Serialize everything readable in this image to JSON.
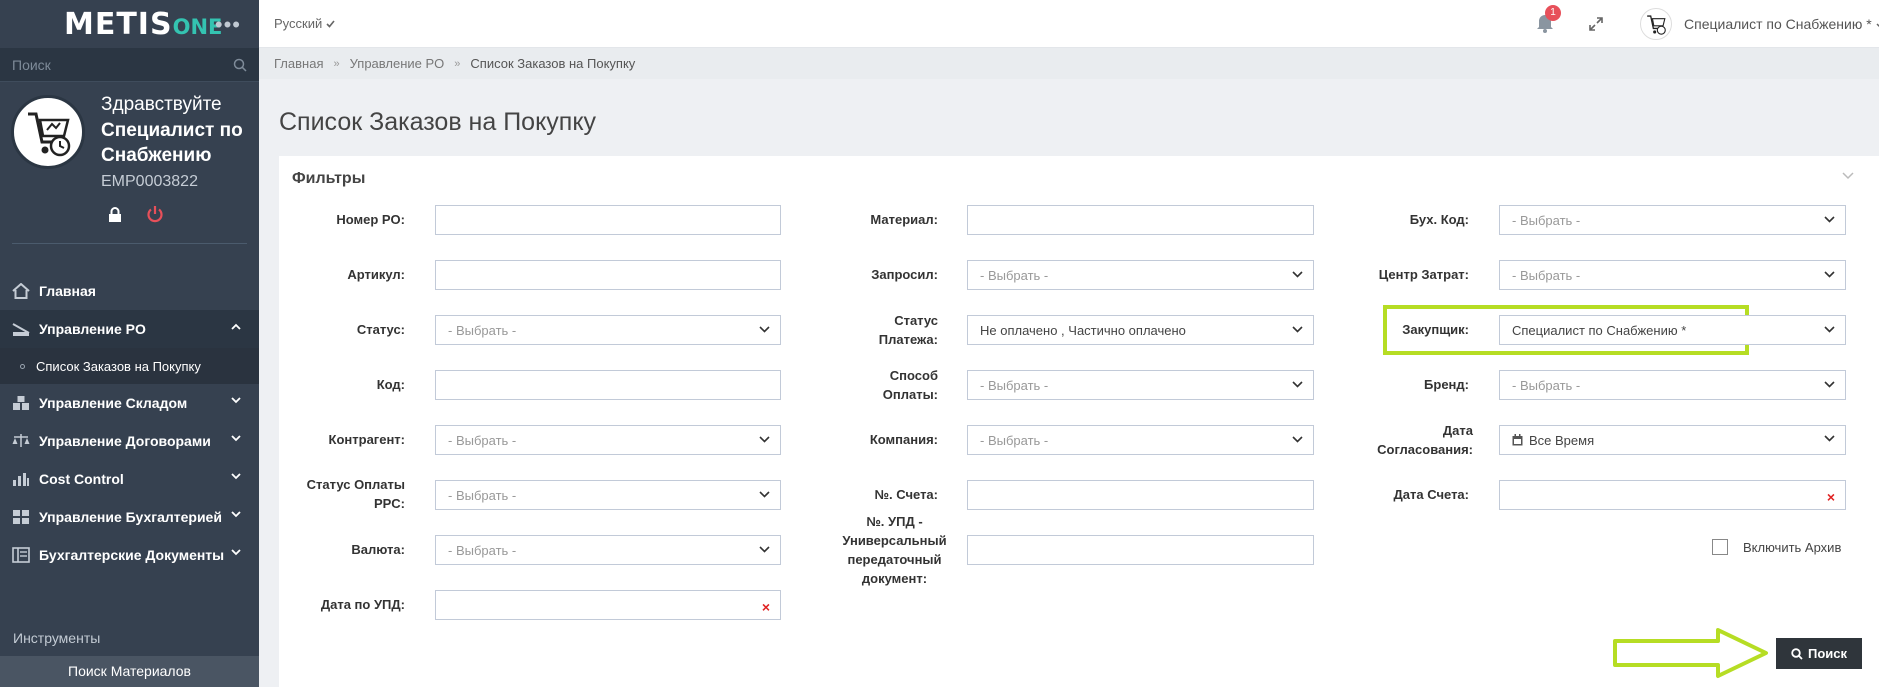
{
  "app": {
    "logo_main": "METIS",
    "logo_accent": "ONE",
    "search_placeholder": "Поиск"
  },
  "profile": {
    "greeting": "Здравствуйте",
    "name": "Специалист по Снабжению",
    "emp_id": "EMP0003822"
  },
  "sidebar": {
    "items": [
      {
        "label": "Главная",
        "icon": "home-icon"
      },
      {
        "label": "Управление PO",
        "icon": "po-icon",
        "expanded": true
      },
      {
        "label": "Управление Складом",
        "icon": "warehouse-icon"
      },
      {
        "label": "Управление Договорами",
        "icon": "contract-icon"
      },
      {
        "label": "Cost Control",
        "icon": "chart-icon"
      },
      {
        "label": "Управление Бухгалтерией",
        "icon": "accounting-icon"
      },
      {
        "label": "Бухгалтерские Документы",
        "icon": "documents-icon"
      }
    ],
    "subitem": "Список Заказов на Покупку",
    "tools_label": "Инструменты",
    "material_search": "Поиск Материалов"
  },
  "header": {
    "language": "Русский",
    "notification_count": "1",
    "user": "Специалист по Снабжению *"
  },
  "breadcrumb": [
    "Главная",
    "Управление PO",
    "Список Заказов на Покупку"
  ],
  "page_title": "Список Заказов на Покупку",
  "filters": {
    "title": "Фильтры",
    "col1": {
      "po_number": {
        "label": "Номер PO:",
        "value": ""
      },
      "article": {
        "label": "Артикул:",
        "value": ""
      },
      "status": {
        "label": "Статус:",
        "value": "- Выбрать -"
      },
      "code": {
        "label": "Код:",
        "value": ""
      },
      "counterparty": {
        "label": "Контрагент:",
        "value": "- Выбрать -"
      },
      "prs_payment_status": {
        "label": "Статус Оплаты PPC:",
        "value": "- Выбрать -"
      },
      "currency": {
        "label": "Валюта:",
        "value": "- Выбрать -"
      },
      "upd_date": {
        "label": "Дата по УПД:",
        "value": ""
      }
    },
    "col2": {
      "material": {
        "label": "Материал:",
        "value": ""
      },
      "requested": {
        "label": "Запросил:",
        "value": "- Выбрать -"
      },
      "payment_status": {
        "label": "Статус Платежа:",
        "value": "Не оплачено , Частично оплачено"
      },
      "payment_method": {
        "label": "Способ Оплаты:",
        "value": "- Выбрать -"
      },
      "company": {
        "label": "Компания:",
        "value": "- Выбрать -"
      },
      "invoice_no": {
        "label": "№. Счета:",
        "value": ""
      },
      "upd_no": {
        "label": "№. УПД - Универсальный передаточный документ:",
        "value": ""
      }
    },
    "col3": {
      "account_code": {
        "label": "Бух. Код:",
        "value": "- Выбрать -"
      },
      "cost_center": {
        "label": "Центр Затрат:",
        "value": "- Выбрать -"
      },
      "buyer": {
        "label": "Закупщик:",
        "value": "Специалист по Снабжению *"
      },
      "brand": {
        "label": "Бренд:",
        "value": "- Выбрать -"
      },
      "approval_date": {
        "label": "Дата Согласования:",
        "value": "Все Время"
      },
      "invoice_date": {
        "label": "Дата Счета:",
        "value": ""
      }
    },
    "include_archive": "Включить Архив",
    "search_button": "Поиск"
  },
  "colors": {
    "sidebar": "#364150",
    "accent": "#34c3b1",
    "highlight": "#b6dd24",
    "danger": "#e7505a"
  }
}
